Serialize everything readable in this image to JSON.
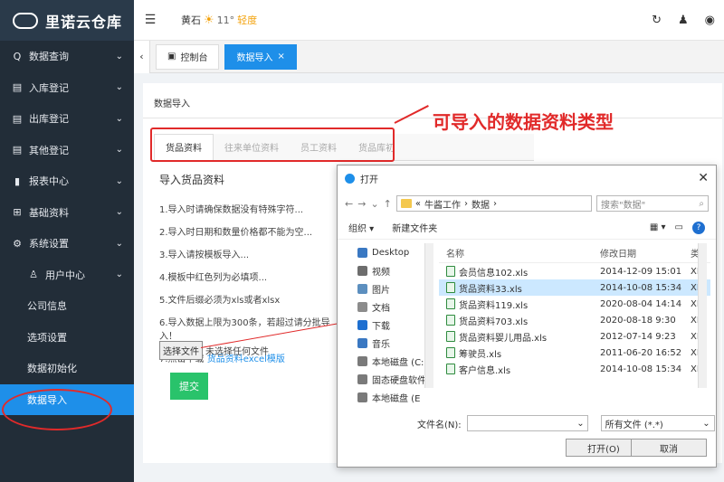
{
  "app": {
    "brand": "里诺云仓库"
  },
  "sidebar": {
    "items": [
      {
        "icon": "search-icon",
        "glyph": "Q",
        "label": "数据查询",
        "chev": "⌄"
      },
      {
        "icon": "document-icon",
        "glyph": "▤",
        "label": "入库登记",
        "chev": "⌄"
      },
      {
        "icon": "document-icon",
        "glyph": "▤",
        "label": "出库登记",
        "chev": "⌄"
      },
      {
        "icon": "document-icon",
        "glyph": "▤",
        "label": "其他登记",
        "chev": "⌄"
      },
      {
        "icon": "bar-chart-icon",
        "glyph": "▮",
        "label": "报表中心",
        "chev": "⌄"
      },
      {
        "icon": "grid-icon",
        "glyph": "⊞",
        "label": "基础资料",
        "chev": "⌄"
      },
      {
        "icon": "gear-icon",
        "glyph": "⚙",
        "label": "系统设置",
        "chev": "⌄"
      }
    ],
    "subitems": [
      {
        "icon": "user-icon",
        "glyph": "♙",
        "label": "用户中心",
        "chev": "⌄"
      },
      {
        "label": "公司信息"
      },
      {
        "label": "选项设置"
      },
      {
        "label": "数据初始化"
      },
      {
        "label": "数据导入"
      }
    ]
  },
  "topbar": {
    "menu_glyph": "☰",
    "city": "黄石",
    "sun_glyph": "☀",
    "temp": "11°",
    "weather": "轻度",
    "refresh_glyph": "↻",
    "user_glyph": "♟",
    "more_glyph": "◉"
  },
  "tabs": {
    "prev_glyph": "‹",
    "items": [
      {
        "label": "控制台",
        "glyph": "▣"
      },
      {
        "label": "数据导入",
        "close": "×"
      }
    ]
  },
  "content": {
    "title": "数据导入",
    "type_tabs": [
      "货品资料",
      "往来单位资料",
      "员工资料",
      "货品库初"
    ],
    "callout": "可导入的数据资料类型",
    "panel_title": "导入货品资料",
    "rules": [
      "1.导入时请确保数据没有特殊字符...",
      "2.导入时日期和数量价格都不能为空...",
      "3.导入请按模板导入...",
      "4.模板中红色列为必填项...",
      "5.文件后缀必须为xls或者xlsx",
      "6.导入数据上限为300条，若超过请分批导入！"
    ],
    "rule7_prefix": "7.点击下载",
    "rule7_link": "货品资料excel模版",
    "file_button": "选择文件",
    "file_hint": "未选择任何文件",
    "submit": "提交"
  },
  "dialog": {
    "title": "打开",
    "close_glyph": "✕",
    "nav_back": "←",
    "nav_fwd": "→",
    "nav_recent": "⌄",
    "nav_up": "↑",
    "path_prefix": "«",
    "path": [
      "牛酱工作",
      "数据"
    ],
    "path_sep": "›",
    "search_placeholder": "搜索\"数据\"",
    "search_glyph": "⌕",
    "organize": "组织 ▾",
    "new_folder": "新建文件夹",
    "view_glyph": "▦ ▾",
    "pane_glyph": "▭",
    "help_glyph": "?",
    "nav_items": [
      {
        "label": "Desktop",
        "color": "#3a78c2"
      },
      {
        "label": "视频",
        "color": "#6d6d6d"
      },
      {
        "label": "图片",
        "color": "#5c8fbf"
      },
      {
        "label": "文档",
        "color": "#8c8c8c"
      },
      {
        "label": "下载",
        "color": "#1e6fd0"
      },
      {
        "label": "音乐",
        "color": "#3a78c2"
      },
      {
        "label": "本地磁盘 (C:)",
        "color": "#7a7a7a"
      },
      {
        "label": "固态硬盘软件 (D",
        "color": "#7a7a7a"
      },
      {
        "label": "本地磁盘 (E",
        "color": "#7a7a7a"
      }
    ],
    "columns": {
      "name": "名称",
      "date": "修改日期",
      "type": "类"
    },
    "files": [
      {
        "name": "会员信息102.xls",
        "date": "2014-12-09 15:01",
        "type": "XL"
      },
      {
        "name": "货品资料33.xls",
        "date": "2014-10-08 15:34",
        "type": "XL"
      },
      {
        "name": "货品资料119.xls",
        "date": "2020-08-04 14:14",
        "type": "XL"
      },
      {
        "name": "货品资料703.xls",
        "date": "2020-08-18 9:30",
        "type": "XL"
      },
      {
        "name": "货品资料婴儿用品.xls",
        "date": "2012-07-14 9:23",
        "type": "XL"
      },
      {
        "name": "筹驶员.xls",
        "date": "2011-06-20 16:52",
        "type": "XL"
      },
      {
        "name": "客户信息.xls",
        "date": "2014-10-08 15:34",
        "type": "XL"
      }
    ],
    "filename_label": "文件名(N):",
    "filename_value": "",
    "dropdown_glyph": "⌄",
    "filetype": "所有文件 (*.*)",
    "open": "打开(O)",
    "cancel": "取消"
  }
}
